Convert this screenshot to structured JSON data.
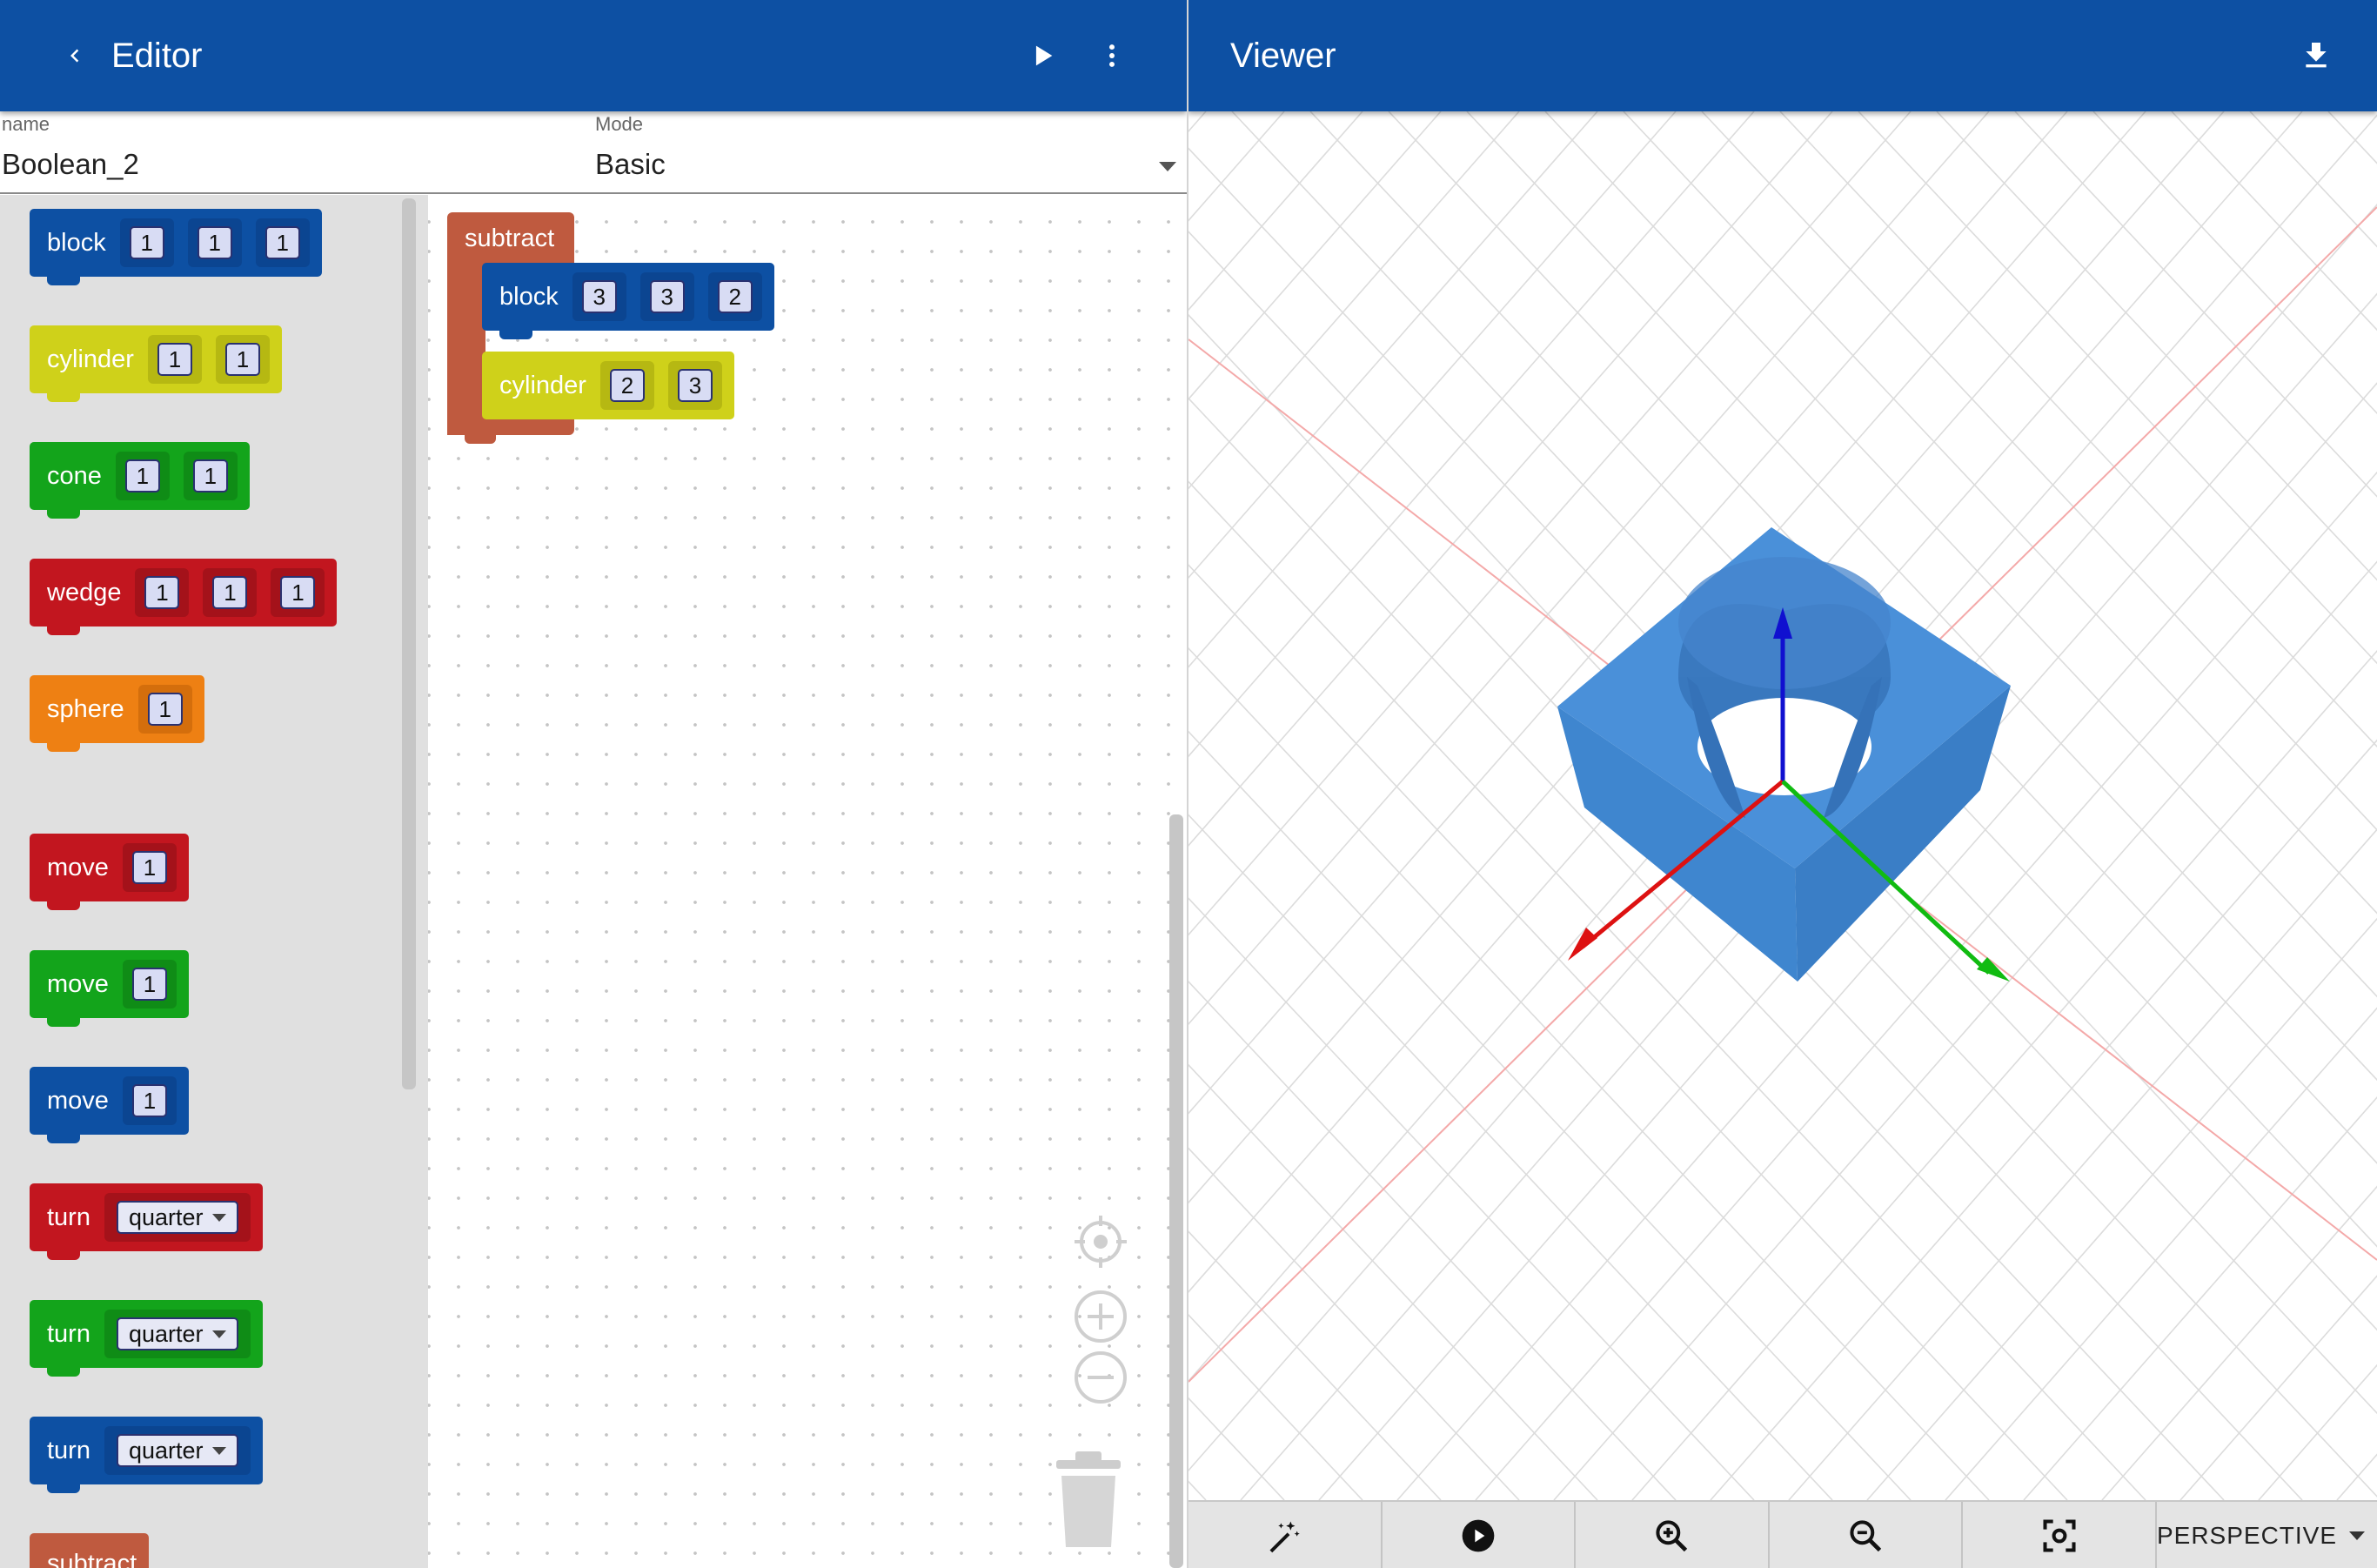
{
  "editor": {
    "title": "Editor",
    "name_label": "name",
    "name_value": "Boolean_2",
    "mode_label": "Mode",
    "mode_value": "Basic"
  },
  "viewer": {
    "title": "Viewer",
    "camera_mode": "PERSPECTIVE"
  },
  "flyout": {
    "block": {
      "label": "block",
      "values": [
        "1",
        "1",
        "1"
      ],
      "color": "#0d50a3"
    },
    "cylinder": {
      "label": "cylinder",
      "values": [
        "1",
        "1"
      ],
      "color": "#cfd11a"
    },
    "cone": {
      "label": "cone",
      "values": [
        "1",
        "1"
      ],
      "color": "#13a41b"
    },
    "wedge": {
      "label": "wedge",
      "values": [
        "1",
        "1",
        "1"
      ],
      "color": "#c2161f"
    },
    "sphere": {
      "label": "sphere",
      "values": [
        "1"
      ],
      "color": "#ee8013"
    },
    "move_x": {
      "label": "move",
      "value": "1",
      "color": "#c2161f"
    },
    "move_y": {
      "label": "move",
      "value": "1",
      "color": "#13a41b"
    },
    "move_z": {
      "label": "move",
      "value": "1",
      "color": "#0d50a3"
    },
    "turn_x": {
      "label": "turn",
      "value": "quarter",
      "color": "#c2161f"
    },
    "turn_y": {
      "label": "turn",
      "value": "quarter",
      "color": "#13a41b"
    },
    "turn_z": {
      "label": "turn",
      "value": "quarter",
      "color": "#0d50a3"
    },
    "subtract": {
      "label": "subtract",
      "color": "#bf5a3f"
    }
  },
  "workspace": {
    "subtract_label": "subtract",
    "block": {
      "label": "block",
      "values": [
        "3",
        "3",
        "2"
      ]
    },
    "cylinder": {
      "label": "cylinder",
      "values": [
        "2",
        "3"
      ]
    }
  },
  "icons": [
    "back-icon",
    "run-icon",
    "more-vert-icon",
    "download-icon",
    "magic-wand-icon",
    "play-circle-icon",
    "zoom-in-icon",
    "zoom-out-icon",
    "focus-icon",
    "recenter-icon",
    "workspace-zoom-in-icon",
    "workspace-zoom-out-icon",
    "trash-icon"
  ]
}
